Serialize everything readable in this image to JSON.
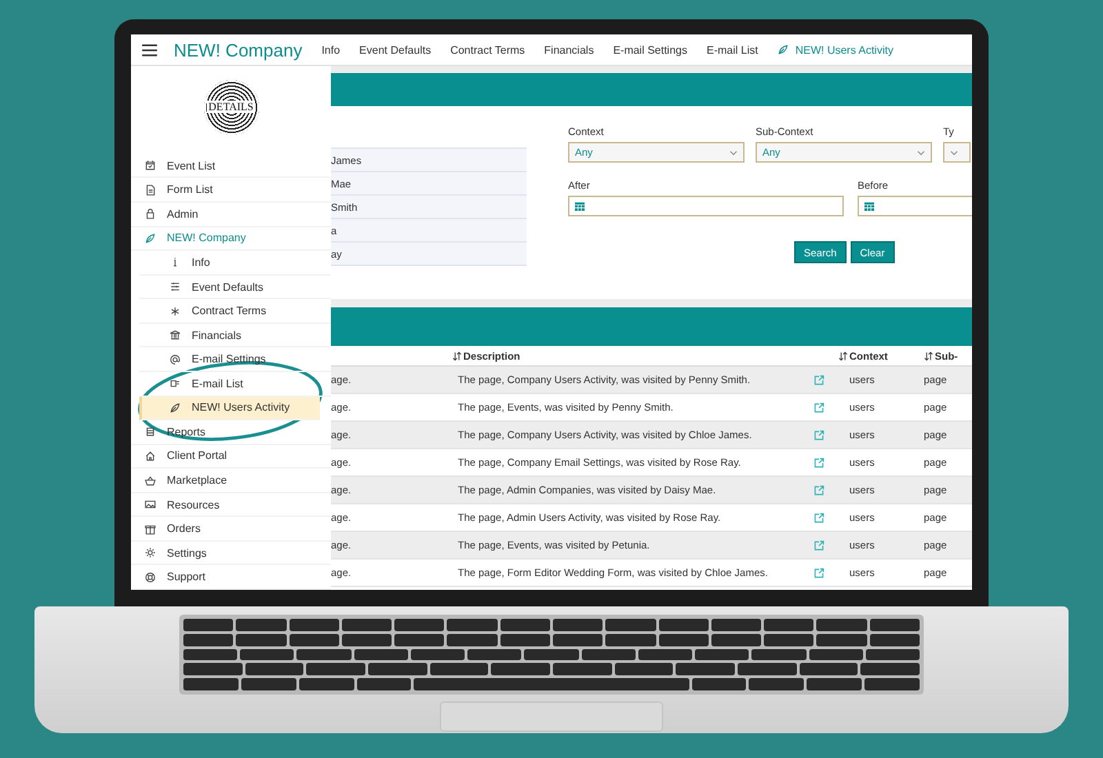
{
  "app_bar": {
    "title": "NEW! Company",
    "tabs": [
      {
        "label": "Info",
        "selected": false
      },
      {
        "label": "Event Defaults",
        "selected": false
      },
      {
        "label": "Contract Terms",
        "selected": false
      },
      {
        "label": "Financials",
        "selected": false
      },
      {
        "label": "E-mail Settings",
        "selected": false
      },
      {
        "label": "E-mail List",
        "selected": false
      },
      {
        "label": "NEW! Users Activity",
        "selected": true
      }
    ]
  },
  "sidebar": {
    "logo_text": "DETAILS",
    "items": [
      {
        "label": "Event List",
        "expanded": false
      },
      {
        "label": "Form List",
        "expanded": false
      },
      {
        "label": "Admin",
        "expanded": false
      },
      {
        "label": "NEW! Company",
        "expanded": true,
        "children": [
          {
            "label": "Info",
            "selected": false
          },
          {
            "label": "Event Defaults",
            "selected": false
          },
          {
            "label": "Contract Terms",
            "selected": false
          },
          {
            "label": "Financials",
            "selected": false
          },
          {
            "label": "E-mail Settings",
            "selected": false
          },
          {
            "label": "E-mail List",
            "selected": false
          },
          {
            "label": "NEW! Users Activity",
            "selected": true
          }
        ]
      },
      {
        "label": "Reports",
        "expanded": false
      },
      {
        "label": "Client Portal",
        "expanded": false
      },
      {
        "label": "Marketplace",
        "expanded": false
      },
      {
        "label": "Resources",
        "expanded": false
      },
      {
        "label": "Orders",
        "expanded": false
      },
      {
        "label": "Settings",
        "expanded": false
      },
      {
        "label": "Support",
        "expanded": false
      }
    ]
  },
  "user_list": [
    "James",
    "Mae",
    "Smith",
    "a",
    "ay"
  ],
  "filters": {
    "selects": [
      {
        "label": "Context",
        "value": "Any"
      },
      {
        "label": "Sub-Context",
        "value": "Any"
      },
      {
        "label": "Ty"
      }
    ],
    "dates": [
      {
        "label": "After"
      },
      {
        "label": "Before"
      }
    ],
    "buttons": [
      "Search",
      "Clear"
    ]
  },
  "table": {
    "columns": [
      "Description",
      "Context",
      "Sub-"
    ],
    "rows": [
      {
        "column_1": "age.",
        "description": "The page, Company Users Activity, was visited by Penny Smith.",
        "context": "users",
        "column_5": "page"
      },
      {
        "column_1": "age.",
        "description": "The page, Events, was visited by Penny Smith.",
        "context": "users",
        "column_5": "page"
      },
      {
        "column_1": "age.",
        "description": "The page, Company Users Activity, was visited by Chloe James.",
        "context": "users",
        "column_5": "page"
      },
      {
        "column_1": "age.",
        "description": "The page, Company Email Settings, was visited by Rose Ray.",
        "context": "users",
        "column_5": "page"
      },
      {
        "column_1": "age.",
        "description": "The page, Admin Companies, was visited by Daisy Mae.",
        "context": "users",
        "column_5": "page"
      },
      {
        "column_1": "age.",
        "description": "The page, Admin Users Activity, was visited by Rose Ray.",
        "context": "users",
        "column_5": "page"
      },
      {
        "column_1": "age.",
        "description": "The page, Events, was visited by Petunia.",
        "context": "users",
        "column_5": "page"
      },
      {
        "column_1": "age.",
        "description": "The page, Form Editor Wedding Form, was visited by Chloe James.",
        "context": "users",
        "column_5": "page"
      }
    ]
  }
}
